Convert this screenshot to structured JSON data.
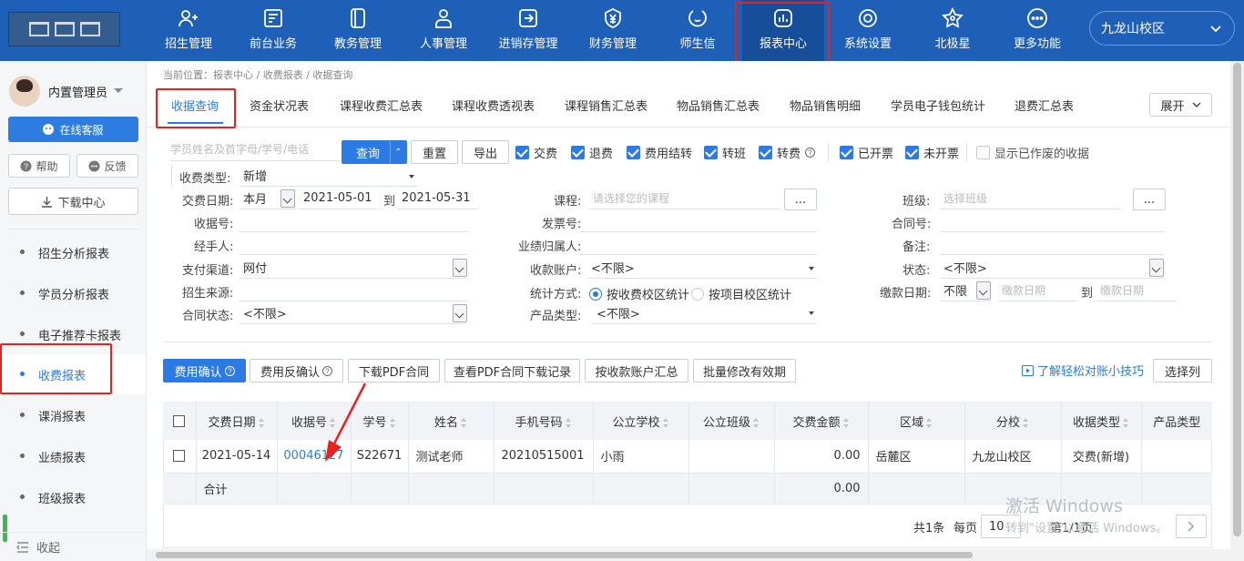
{
  "topnav": {
    "logo_text": "",
    "items": [
      {
        "label": "招生管理",
        "icon": "user-add-icon"
      },
      {
        "label": "前台业务",
        "icon": "form-icon"
      },
      {
        "label": "教务管理",
        "icon": "book-icon"
      },
      {
        "label": "人事管理",
        "icon": "person-icon"
      },
      {
        "label": "进销存管理",
        "icon": "inventory-icon"
      },
      {
        "label": "财务管理",
        "icon": "yen-shield-icon"
      },
      {
        "label": "师生信",
        "icon": "chat-bubble-icon"
      },
      {
        "label": "报表中心",
        "icon": "bar-chart-icon",
        "active": true
      },
      {
        "label": "系统设置",
        "icon": "gear-icon"
      },
      {
        "label": "北极星",
        "icon": "star-icon"
      },
      {
        "label": "更多功能",
        "icon": "more-icon"
      }
    ],
    "campus": "九龙山校区"
  },
  "sidebar": {
    "username": "内置管理员",
    "service_button": "在线客服",
    "help_button": "帮助",
    "feedback_button": "反馈",
    "download_center": "下载中心",
    "items": [
      {
        "label": "招生分析报表"
      },
      {
        "label": "学员分析报表"
      },
      {
        "label": "电子推荐卡报表"
      },
      {
        "label": "收费报表",
        "active": true
      },
      {
        "label": "课消报表"
      },
      {
        "label": "业绩报表"
      },
      {
        "label": "班级报表"
      }
    ],
    "collapse": "收起"
  },
  "breadcrumb": "当前位置：报表中心 / 收费报表 / 收据查询",
  "tabs": [
    "收据查询",
    "资金状况表",
    "课程收费汇总表",
    "课程收费透视表",
    "课程销售汇总表",
    "物品销售汇总表",
    "物品销售明细",
    "学员电子钱包统计",
    "退费汇总表"
  ],
  "expand_label": "展开",
  "toolbar": {
    "search_placeholder": "学员姓名及首字母/学号/电话",
    "query": "查询",
    "reset": "重置",
    "export": "导出",
    "checks": [
      {
        "label": "交费",
        "checked": true
      },
      {
        "label": "退费",
        "checked": true
      },
      {
        "label": "费用结转",
        "checked": true
      },
      {
        "label": "转班",
        "checked": true
      },
      {
        "label": "转费",
        "checked": true
      },
      {
        "label": "已开票",
        "checked": true
      },
      {
        "label": "未开票",
        "checked": true
      },
      {
        "label": "显示已作废的收据",
        "checked": false
      }
    ]
  },
  "filters": {
    "fee_type_label": "收费类型:",
    "fee_type_value": "新增",
    "date_label": "交费日期:",
    "date_period": "本月",
    "date_from": "2021-05-01",
    "to": "到",
    "date_to": "2021-05-31",
    "course_label": "课程:",
    "course_placeholder": "请选择您的课程",
    "class_label": "班级:",
    "class_placeholder": "选择班级",
    "receipt_label": "收据号:",
    "invoice_label": "发票号:",
    "contract_label": "合同号:",
    "handler_label": "经手人:",
    "performer_label": "业绩归属人:",
    "remark_label": "备注:",
    "pay_channel_label": "支付渠道:",
    "pay_channel_value": "网付",
    "account_label": "收款账户:",
    "account_value": "<不限>",
    "status_label": "状态:",
    "status_value": "<不限>",
    "source_label": "招生来源:",
    "stat_label": "统计方式:",
    "stat_option1": "按收费校区统计",
    "stat_option2": "按项目校区统计",
    "pay_date_label": "缴款日期:",
    "pay_date_mode": "不限",
    "pay_date_placeholder": "缴款日期",
    "pay_to": "到",
    "contract_status_label": "合同状态:",
    "contract_status_value": "<不限>",
    "product_type_label": "产品类型:",
    "product_type_value": "<不限>",
    "dots": "..."
  },
  "actions": {
    "confirm": "费用确认",
    "unconfirm": "费用反确认",
    "download_pdf": "下载PDF合同",
    "view_pdf_log": "查看PDF合同下载记录",
    "by_account": "按收款账户汇总",
    "batch_modify": "批量修改有效期",
    "help_link": "了解轻松对账小技巧",
    "choose_columns": "选择列"
  },
  "table": {
    "columns": [
      "交费日期",
      "收据号",
      "学号",
      "姓名",
      "手机号码",
      "公立学校",
      "公立班级",
      "交费金额",
      "区域",
      "分校",
      "收据类型",
      "产品类型"
    ],
    "rows": [
      {
        "date": "2021-05-14",
        "receipt": "00046127",
        "sid": "S22671",
        "name": "测试老师",
        "phone": "20210515001",
        "school": "小雨",
        "class": "",
        "amount": "0.00",
        "region": "岳麓区",
        "branch": "九龙山校区",
        "rtype": "交费(新增)",
        "ptype": ""
      }
    ],
    "total_label": "合计",
    "total_amount": "0.00"
  },
  "pager": {
    "count": "共1条",
    "per_page_label": "每页",
    "per_page": "10",
    "page": "第1/1页"
  },
  "watermark": {
    "line1": "激活 Windows",
    "line2": "转到\"设置\"以激活 Windows。"
  }
}
